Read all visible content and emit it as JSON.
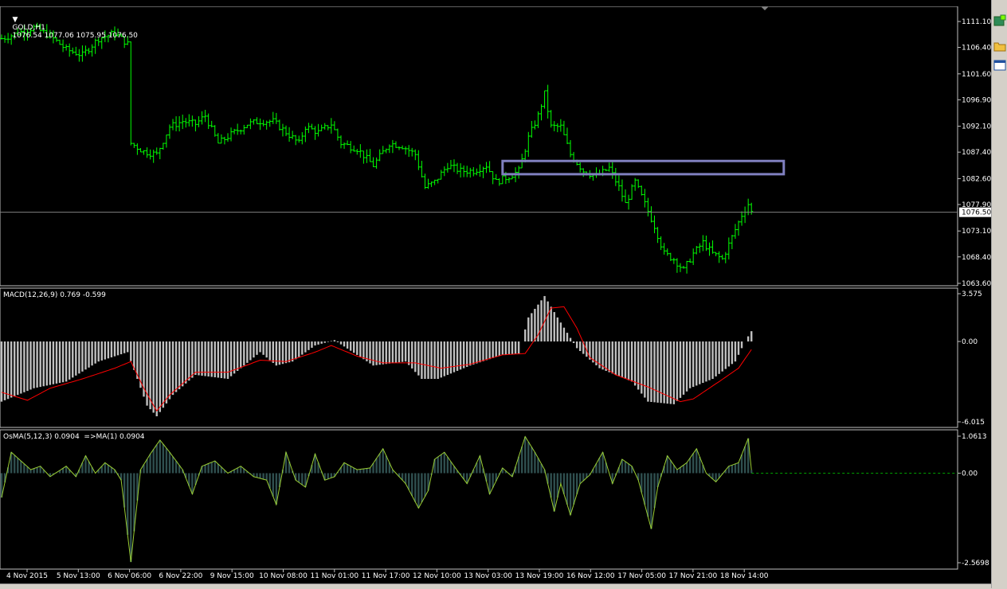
{
  "window": {
    "symbol_title": "GOLD,H1",
    "ohlc": "1076.54 1077.06 1075.95 1076.50",
    "current_price_label": "1076.50",
    "current_price": 1076.5
  },
  "colors": {
    "background": "#000000",
    "candles": "#00ff00",
    "price_line": "#808080",
    "macd_histogram": "#c0c0c0",
    "macd_signal": "#ff0000",
    "osma_fill": "#2f4f4f",
    "osma_line": "#9acd32",
    "zero_line": "#00a000",
    "rectangle": "#8080c0",
    "axis_text": "#ffffff"
  },
  "indicators": {
    "macd_label": "MACD(12,26,9) 0.769 -0.599",
    "osma_label": "OsMA(5,12,3) 0.0904  =>MA(1) 0.0904"
  },
  "toolbar": {
    "icons": [
      "new-order-icon",
      "folder-icon",
      "window-icon"
    ]
  },
  "chart_data": [
    {
      "type": "candlestick",
      "title": "GOLD,H1",
      "yticks": [
        "1111.10",
        "1106.40",
        "1101.60",
        "1096.90",
        "1092.10",
        "1087.40",
        "1082.60",
        "1077.90",
        "1073.10",
        "1068.40",
        "1063.60"
      ],
      "ylim": [
        1063.6,
        1111.1
      ],
      "xticks": [
        "4 Nov 2015",
        "5 Nov 13:00",
        "6 Nov 06:00",
        "6 Nov 22:00",
        "9 Nov 15:00",
        "10 Nov 08:00",
        "11 Nov 01:00",
        "11 Nov 17:00",
        "12 Nov 10:00",
        "13 Nov 03:00",
        "13 Nov 19:00",
        "16 Nov 12:00",
        "17 Nov 05:00",
        "17 Nov 21:00",
        "18 Nov 14:00"
      ],
      "price_anchors": [
        [
          0,
          1108
        ],
        [
          5,
          1109
        ],
        [
          10,
          1110
        ],
        [
          15,
          1108.5
        ],
        [
          20,
          1106
        ],
        [
          25,
          1105
        ],
        [
          30,
          1108
        ],
        [
          35,
          1109
        ],
        [
          39,
          1107
        ],
        [
          40,
          1089
        ],
        [
          44,
          1087.5
        ],
        [
          48,
          1087
        ],
        [
          52,
          1092
        ],
        [
          56,
          1093
        ],
        [
          60,
          1092.5
        ],
        [
          63,
          1094
        ],
        [
          67,
          1089
        ],
        [
          72,
          1091
        ],
        [
          76,
          1092.5
        ],
        [
          80,
          1093
        ],
        [
          84,
          1093
        ],
        [
          88,
          1091
        ],
        [
          92,
          1089
        ],
        [
          94,
          1092
        ],
        [
          98,
          1091
        ],
        [
          102,
          1092.5
        ],
        [
          105,
          1089
        ],
        [
          110,
          1088
        ],
        [
          115,
          1085
        ],
        [
          120,
          1089
        ],
        [
          124,
          1088.5
        ],
        [
          128,
          1087
        ],
        [
          131,
          1081
        ],
        [
          134,
          1082
        ],
        [
          138,
          1085
        ],
        [
          142,
          1084
        ],
        [
          146,
          1084
        ],
        [
          150,
          1085
        ],
        [
          153,
          1082
        ],
        [
          157,
          1083
        ],
        [
          160,
          1084
        ],
        [
          163,
          1090
        ],
        [
          166,
          1094
        ],
        [
          168,
          1098
        ],
        [
          170,
          1092
        ],
        [
          173,
          1092
        ],
        [
          176,
          1087
        ],
        [
          180,
          1084
        ],
        [
          184,
          1083
        ],
        [
          188,
          1084.5
        ],
        [
          191,
          1081
        ],
        [
          193,
          1078
        ],
        [
          196,
          1082
        ],
        [
          199,
          1078
        ],
        [
          202,
          1074
        ],
        [
          205,
          1069
        ],
        [
          208,
          1068
        ],
        [
          211,
          1066
        ],
        [
          214,
          1069
        ],
        [
          217,
          1071
        ],
        [
          220,
          1069
        ],
        [
          223,
          1068
        ],
        [
          226,
          1072
        ],
        [
          229,
          1076
        ],
        [
          231,
          1078
        ],
        [
          232,
          1076.5
        ]
      ],
      "rectangle": {
        "from_bar": 155,
        "to_bar": 242,
        "price_high": 1085.8,
        "price_low": 1083.4
      }
    },
    {
      "type": "bar",
      "title": "MACD(12,26,9) 0.769 -0.599",
      "yticks": [
        "3.575",
        "0.00",
        "-6.015"
      ],
      "ylim": [
        -6.015,
        3.575
      ],
      "histogram_anchors": [
        [
          0,
          -4.5
        ],
        [
          10,
          -3.5
        ],
        [
          20,
          -3.0
        ],
        [
          30,
          -1.5
        ],
        [
          39,
          -0.8
        ],
        [
          45,
          -4.8
        ],
        [
          48,
          -5.6
        ],
        [
          53,
          -4.0
        ],
        [
          60,
          -2.5
        ],
        [
          70,
          -2.8
        ],
        [
          80,
          -0.8
        ],
        [
          85,
          -1.8
        ],
        [
          90,
          -1.5
        ],
        [
          97,
          -0.3
        ],
        [
          103,
          0.1
        ],
        [
          115,
          -1.8
        ],
        [
          125,
          -1.5
        ],
        [
          130,
          -2.8
        ],
        [
          135,
          -2.8
        ],
        [
          145,
          -1.8
        ],
        [
          155,
          -1.0
        ],
        [
          160,
          -0.9
        ],
        [
          163,
          1.8
        ],
        [
          168,
          3.4
        ],
        [
          172,
          1.8
        ],
        [
          178,
          -0.5
        ],
        [
          185,
          -2.0
        ],
        [
          195,
          -3.0
        ],
        [
          200,
          -4.5
        ],
        [
          208,
          -4.7
        ],
        [
          213,
          -3.5
        ],
        [
          220,
          -2.8
        ],
        [
          227,
          -1.5
        ],
        [
          230,
          0.0
        ],
        [
          232,
          0.769
        ]
      ],
      "signal_anchors": [
        [
          0,
          -3.8
        ],
        [
          8,
          -4.4
        ],
        [
          15,
          -3.5
        ],
        [
          25,
          -2.8
        ],
        [
          35,
          -2.0
        ],
        [
          40,
          -1.5
        ],
        [
          44,
          -3.5
        ],
        [
          48,
          -5.2
        ],
        [
          52,
          -4.0
        ],
        [
          60,
          -2.3
        ],
        [
          70,
          -2.3
        ],
        [
          80,
          -1.4
        ],
        [
          88,
          -1.5
        ],
        [
          97,
          -0.8
        ],
        [
          102,
          -0.3
        ],
        [
          110,
          -1.1
        ],
        [
          118,
          -1.6
        ],
        [
          128,
          -1.6
        ],
        [
          136,
          -2.0
        ],
        [
          145,
          -1.7
        ],
        [
          155,
          -1.0
        ],
        [
          162,
          -0.9
        ],
        [
          166,
          0.5
        ],
        [
          170,
          2.5
        ],
        [
          174,
          2.6
        ],
        [
          178,
          1.0
        ],
        [
          182,
          -1.2
        ],
        [
          190,
          -2.5
        ],
        [
          200,
          -3.4
        ],
        [
          210,
          -4.5
        ],
        [
          214,
          -4.3
        ],
        [
          222,
          -3.0
        ],
        [
          228,
          -2.0
        ],
        [
          232,
          -0.599
        ]
      ]
    },
    {
      "type": "area",
      "title": "OsMA(5,12,3) 0.0904  =>MA(1) 0.0904",
      "yticks": [
        "1.0613",
        "0.00",
        "-2.5698"
      ],
      "ylim": [
        -2.5698,
        1.0613
      ],
      "anchors": [
        [
          0,
          -0.7
        ],
        [
          3,
          0.6
        ],
        [
          6,
          0.35
        ],
        [
          9,
          0.1
        ],
        [
          12,
          0.2
        ],
        [
          15,
          -0.1
        ],
        [
          20,
          0.2
        ],
        [
          23,
          -0.1
        ],
        [
          26,
          0.5
        ],
        [
          29,
          0.0
        ],
        [
          32,
          0.3
        ],
        [
          35,
          0.1
        ],
        [
          37,
          -0.2
        ],
        [
          40,
          -2.55
        ],
        [
          43,
          0.1
        ],
        [
          46,
          0.55
        ],
        [
          49,
          0.95
        ],
        [
          52,
          0.6
        ],
        [
          56,
          0.1
        ],
        [
          59,
          -0.6
        ],
        [
          62,
          0.2
        ],
        [
          66,
          0.35
        ],
        [
          70,
          0.0
        ],
        [
          74,
          0.2
        ],
        [
          78,
          -0.1
        ],
        [
          82,
          -0.2
        ],
        [
          85,
          -0.9
        ],
        [
          88,
          0.6
        ],
        [
          91,
          -0.2
        ],
        [
          94,
          -0.4
        ],
        [
          97,
          0.55
        ],
        [
          100,
          -0.2
        ],
        [
          103,
          -0.1
        ],
        [
          106,
          0.3
        ],
        [
          110,
          0.1
        ],
        [
          114,
          0.15
        ],
        [
          118,
          0.7
        ],
        [
          121,
          0.1
        ],
        [
          125,
          -0.3
        ],
        [
          129,
          -1.0
        ],
        [
          132,
          -0.5
        ],
        [
          134,
          0.4
        ],
        [
          137,
          0.6
        ],
        [
          140,
          0.2
        ],
        [
          144,
          -0.3
        ],
        [
          148,
          0.5
        ],
        [
          151,
          -0.6
        ],
        [
          155,
          0.15
        ],
        [
          158,
          -0.1
        ],
        [
          162,
          1.05
        ],
        [
          165,
          0.6
        ],
        [
          168,
          0.1
        ],
        [
          171,
          -1.1
        ],
        [
          173,
          -0.3
        ],
        [
          176,
          -1.2
        ],
        [
          179,
          -0.3
        ],
        [
          182,
          -0.05
        ],
        [
          186,
          0.6
        ],
        [
          189,
          -0.3
        ],
        [
          192,
          0.4
        ],
        [
          195,
          0.2
        ],
        [
          197,
          -0.2
        ],
        [
          201,
          -1.6
        ],
        [
          203,
          -0.4
        ],
        [
          206,
          0.5
        ],
        [
          209,
          0.1
        ],
        [
          212,
          0.3
        ],
        [
          215,
          0.7
        ],
        [
          218,
          0.0
        ],
        [
          221,
          -0.25
        ],
        [
          225,
          0.2
        ],
        [
          228,
          0.3
        ],
        [
          231,
          1.0
        ],
        [
          232,
          0.0904
        ]
      ]
    }
  ]
}
